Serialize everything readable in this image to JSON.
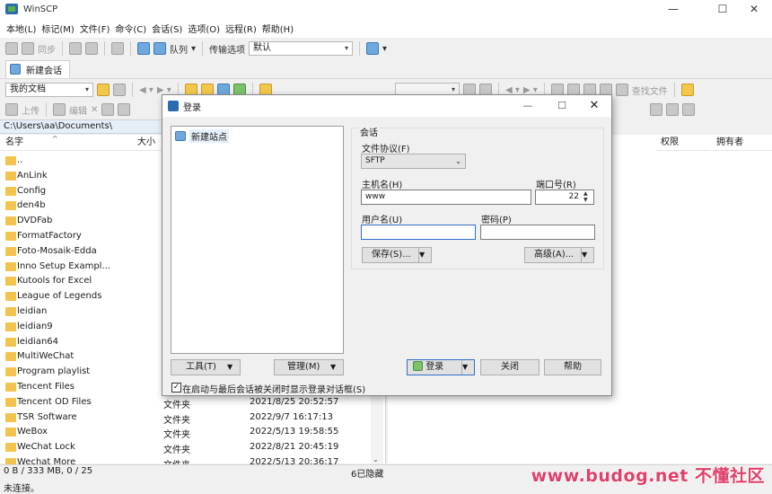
{
  "window": {
    "title": "WinSCP",
    "minimize": "—",
    "maximize": "☐",
    "close": "✕"
  },
  "menu": [
    "本地(L)",
    "标记(M)",
    "文件(F)",
    "命令(C)",
    "会话(S)",
    "选项(O)",
    "远程(R)",
    "帮助(H)"
  ],
  "toolbar1": {
    "sync_label": "同步",
    "queue_label": "队列",
    "transfer_label": "传输选项",
    "transfer_value": "默认"
  },
  "tabs": {
    "new_session": "新建会话"
  },
  "local_toolbar": {
    "location": "我的文档"
  },
  "local_actions": {
    "upload": "上传",
    "edit": "编辑"
  },
  "remote_toolbar": {
    "find_files": "查找文件"
  },
  "local_path": "C:\\Users\\aa\\Documents\\",
  "local_columns": {
    "name": "名字",
    "size": "大小"
  },
  "remote_columns": {
    "rights": "权限",
    "owner": "拥有者"
  },
  "files": [
    {
      "name": "..",
      "type": "",
      "date": ""
    },
    {
      "name": "AnLink",
      "type": "",
      "date": ""
    },
    {
      "name": "Config",
      "type": "",
      "date": ""
    },
    {
      "name": "den4b",
      "type": "",
      "date": ""
    },
    {
      "name": "DVDFab",
      "type": "",
      "date": ""
    },
    {
      "name": "FormatFactory",
      "type": "",
      "date": ""
    },
    {
      "name": "Foto-Mosaik-Edda",
      "type": "",
      "date": ""
    },
    {
      "name": "Inno Setup Exampl...",
      "type": "",
      "date": ""
    },
    {
      "name": "Kutools for Excel",
      "type": "",
      "date": ""
    },
    {
      "name": "League of Legends",
      "type": "",
      "date": ""
    },
    {
      "name": "leidian",
      "type": "",
      "date": ""
    },
    {
      "name": "leidian9",
      "type": "",
      "date": ""
    },
    {
      "name": "leidian64",
      "type": "",
      "date": ""
    },
    {
      "name": "MultiWeChat",
      "type": "",
      "date": ""
    },
    {
      "name": "Program playlist",
      "type": "",
      "date": ""
    },
    {
      "name": "Tencent Files",
      "type": "",
      "date": ""
    },
    {
      "name": "Tencent OD Files",
      "type": "文件夹",
      "date": "2021/8/25  20:52:57"
    },
    {
      "name": "TSR Software",
      "type": "文件夹",
      "date": "2022/9/7  16:17:13"
    },
    {
      "name": "WeBox",
      "type": "文件夹",
      "date": "2022/5/13  19:58:55"
    },
    {
      "name": "WeChat Lock",
      "type": "文件夹",
      "date": "2022/8/21  20:45:19"
    },
    {
      "name": "Wechat More",
      "type": "文件夹",
      "date": "2022/5/13  20:36:17"
    }
  ],
  "status": {
    "left": "0 B / 333 MB,  0 / 25",
    "hidden": "6已隐藏",
    "connection": "未连接。"
  },
  "watermark": "www.budog.net 不懂社区",
  "dialog": {
    "title": "登录",
    "new_site": "新建站点",
    "session_group": "会话",
    "protocol_label": "文件协议(F)",
    "protocol_value": "SFTP",
    "host_label": "主机名(H)",
    "host_value": "www",
    "port_label": "端口号(R)",
    "port_value": "22",
    "user_label": "用户名(U)",
    "user_value": "",
    "password_label": "密码(P)",
    "password_value": "",
    "save_button": "保存(S)...",
    "advanced_button": "高级(A)...",
    "tools_button": "工具(T)",
    "manage_button": "管理(M)",
    "login_button": "登录",
    "close_button": "关闭",
    "help_button": "帮助",
    "startup_checkbox": "在启动与最后会话被关闭时显示登录对话框(S)"
  }
}
